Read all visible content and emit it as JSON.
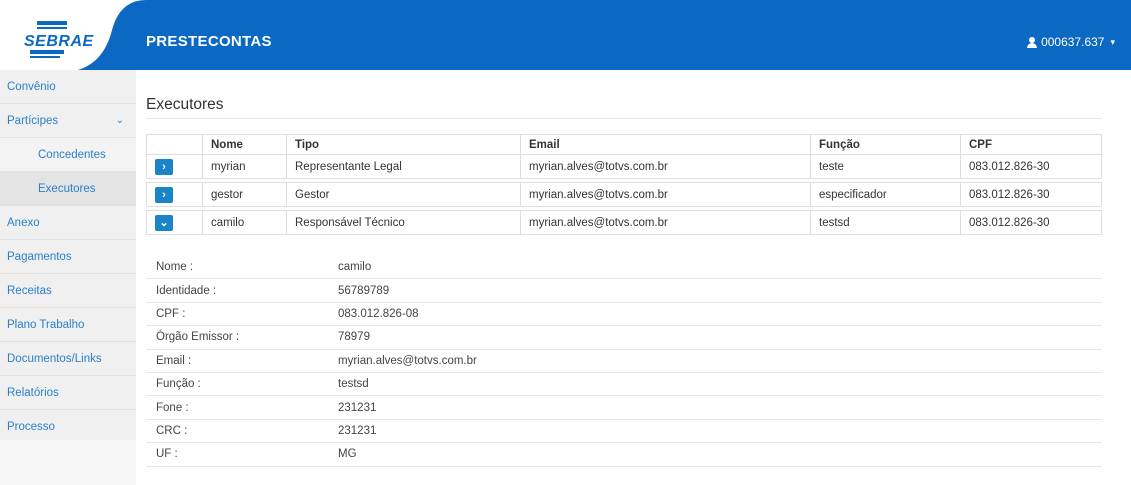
{
  "header": {
    "logo_text": "SEBRAE",
    "app_title": "PRESTECONTAS",
    "user_label": "000637.637",
    "colors": {
      "brand": "#0b68c3",
      "link": "#2a7fcb",
      "button": "#1b84c9"
    }
  },
  "sidebar": {
    "items": [
      {
        "label": "Convênio"
      },
      {
        "label": "Partícipes"
      },
      {
        "label": "Concedentes"
      },
      {
        "label": "Executores"
      },
      {
        "label": "Anexo"
      },
      {
        "label": "Pagamentos"
      },
      {
        "label": "Receitas"
      },
      {
        "label": "Plano Trabalho"
      },
      {
        "label": "Documentos/Links"
      },
      {
        "label": "Relatórios"
      },
      {
        "label": "Processo"
      }
    ]
  },
  "main": {
    "title": "Executores",
    "table": {
      "headers": [
        "Nome",
        "Tipo",
        "Email",
        "Função",
        "CPF"
      ],
      "rows": [
        {
          "nome": "myrian",
          "tipo": "Representante Legal",
          "email": "myrian.alves@totvs.com.br",
          "funcao": "teste",
          "cpf": "083.012.826-30",
          "expanded": false
        },
        {
          "nome": "gestor",
          "tipo": "Gestor",
          "email": "myrian.alves@totvs.com.br",
          "funcao": "especificador",
          "cpf": "083.012.826-30",
          "expanded": false
        },
        {
          "nome": "camilo",
          "tipo": "Responsável Técnico",
          "email": "myrian.alves@totvs.com.br",
          "funcao": "testsd",
          "cpf": "083.012.826-30",
          "expanded": true
        }
      ]
    },
    "details": [
      {
        "label": "Nome :",
        "value": "camilo"
      },
      {
        "label": "Identidade :",
        "value": "56789789"
      },
      {
        "label": "CPF :",
        "value": "083.012.826-08"
      },
      {
        "label": "Órgão Emissor :",
        "value": "78979"
      },
      {
        "label": "Email :",
        "value": "myrian.alves@totvs.com.br"
      },
      {
        "label": "Função :",
        "value": "testsd"
      },
      {
        "label": "Fone :",
        "value": "231231"
      },
      {
        "label": "CRC :",
        "value": "231231"
      },
      {
        "label": "UF :",
        "value": "MG"
      }
    ]
  }
}
